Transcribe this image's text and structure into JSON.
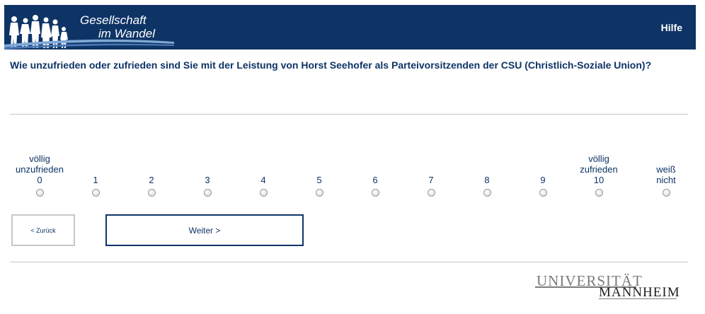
{
  "header": {
    "logo_line1": "Gesellschaft",
    "logo_line2": "im Wandel",
    "help_label": "Hilfe"
  },
  "question": "Wie unzufrieden oder zufrieden sind Sie mit der Leistung von Horst Seehofer als Parteivorsitzenden der CSU (Christlich-Soziale Union)?",
  "scale": {
    "options": [
      {
        "anchor": "völlig unzufrieden",
        "label": "0"
      },
      {
        "anchor": "",
        "label": "1"
      },
      {
        "anchor": "",
        "label": "2"
      },
      {
        "anchor": "",
        "label": "3"
      },
      {
        "anchor": "",
        "label": "4"
      },
      {
        "anchor": "",
        "label": "5"
      },
      {
        "anchor": "",
        "label": "6"
      },
      {
        "anchor": "",
        "label": "7"
      },
      {
        "anchor": "",
        "label": "8"
      },
      {
        "anchor": "",
        "label": "9"
      },
      {
        "anchor": "völlig zufrieden",
        "label": "10"
      },
      {
        "anchor": "",
        "label": "weiß nicht"
      }
    ],
    "selected": null
  },
  "nav": {
    "back_label": "< Zurück",
    "next_label": "Weiter >"
  },
  "footer": {
    "logo_word1": "UNIVERSITÄT",
    "logo_word2": "MANNHEIM"
  },
  "colors": {
    "brand_navy": "#0e3466",
    "rule_gray": "#c7c7c7"
  }
}
